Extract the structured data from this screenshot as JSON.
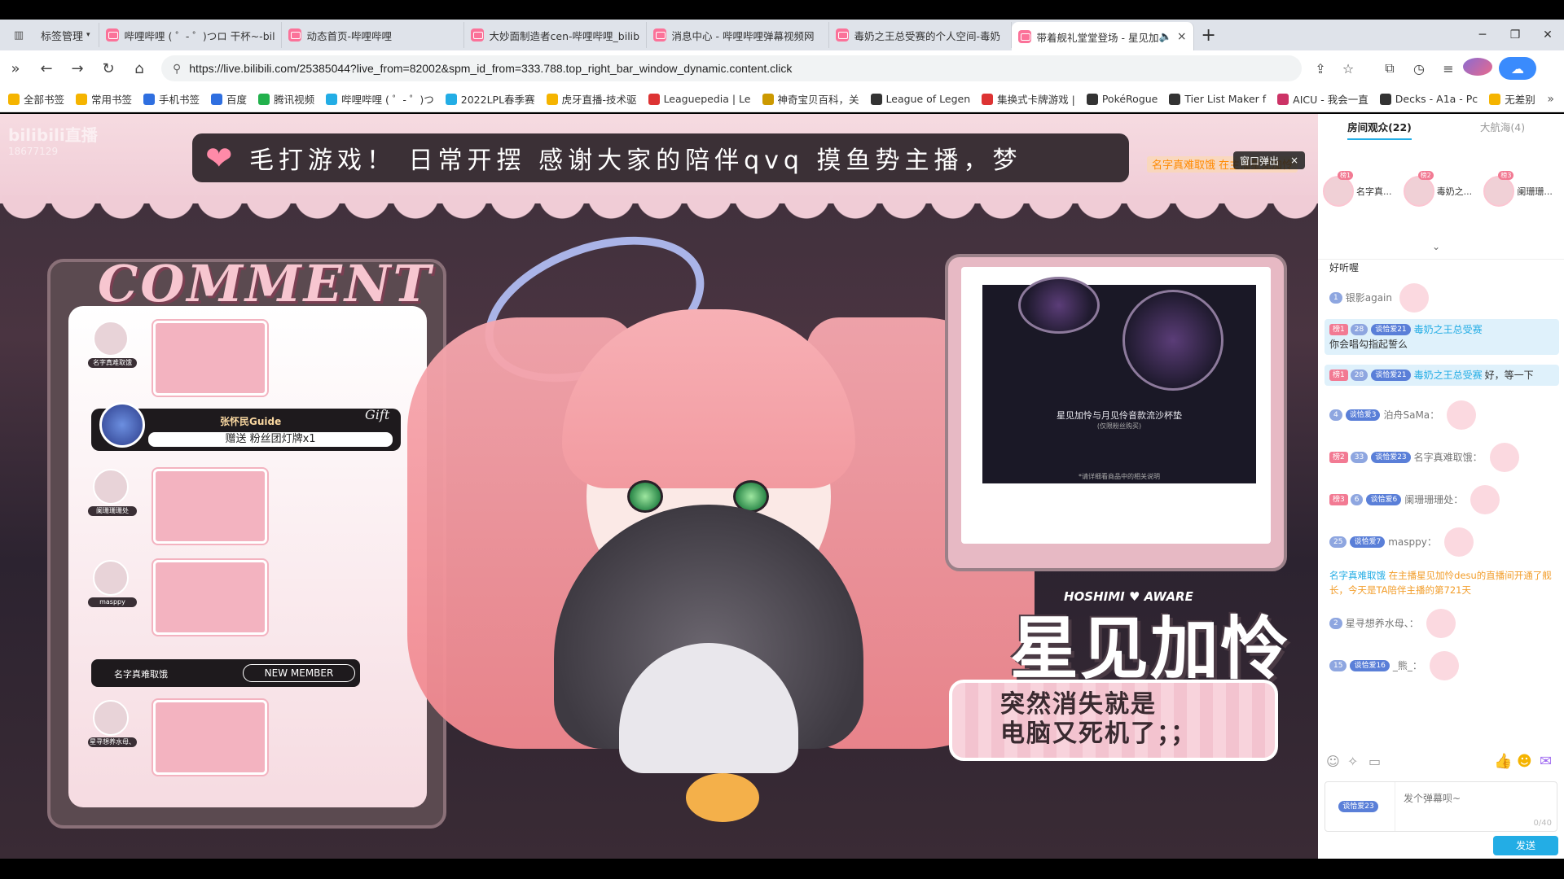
{
  "tabbar": {
    "bookmark_manager": "标签管理",
    "tabs": [
      {
        "title": "哔哩哔哩 ( ゜- ゜)つロ 干杯~-bili"
      },
      {
        "title": "动态首页-哔哩哔哩"
      },
      {
        "title": "大妙面制造者cen-哔哩哔哩_bilib"
      },
      {
        "title": "消息中心 - 哔哩哔哩弹幕视频网"
      },
      {
        "title": "毒奶之王总受赛的个人空间-毒奶"
      },
      {
        "title": "带着舰礼堂堂登场 - 星见加"
      }
    ],
    "new_tab": "+"
  },
  "address": {
    "url": "https://live.bilibili.com/25385044?live_from=82002&spm_id_from=333.788.top_right_bar_window_dynamic.content.click"
  },
  "bookmarks": [
    {
      "label": "全部书签",
      "color": "#f5b400"
    },
    {
      "label": "常用书签",
      "color": "#f5b400"
    },
    {
      "label": "手机书签",
      "color": "#2f6fe0"
    },
    {
      "label": "百度",
      "color": "#2f6fe0"
    },
    {
      "label": "腾讯视频",
      "color": "#22b14c"
    },
    {
      "label": "哔哩哔哩 ( ゜- ゜)つ",
      "color": "#23ade5"
    },
    {
      "label": "2022LPL春季赛",
      "color": "#23ade5"
    },
    {
      "label": "虎牙直播-技术驱",
      "color": "#f5b400"
    },
    {
      "label": "Leaguepedia | Le",
      "color": "#d33"
    },
    {
      "label": "神奇宝贝百科，关",
      "color": "#c90"
    },
    {
      "label": "League of Legen",
      "color": "#333"
    },
    {
      "label": "集换式卡牌游戏 |",
      "color": "#d33"
    },
    {
      "label": "PokéRogue",
      "color": "#333"
    },
    {
      "label": "Tier List Maker f",
      "color": "#333"
    },
    {
      "label": "AICU - 我会一直",
      "color": "#c36"
    },
    {
      "label": "Decks - A1a - Pc",
      "color": "#333"
    },
    {
      "label": "无差别",
      "color": "#f5b400"
    }
  ],
  "stream": {
    "watermark": "bilibili直播",
    "room_number": "18677129",
    "marquee": "毛打游戏！ 日常开摆 感谢大家的陪伴qvq 摸鱼势主播，梦",
    "popout": "窗口弹出",
    "enter_notice": "名字真难取饿 在主播星见加怜",
    "comment_title": "COMMENT",
    "comments": [
      {
        "name": "名字真难取饿"
      },
      {
        "name": "阑珊珊珊处"
      },
      {
        "name": "masppy"
      },
      {
        "name": "星寻想养水母、"
      }
    ],
    "gift": {
      "name": "张怀民Guide",
      "text": "赠送 粉丝团灯牌x1",
      "tag": "Gift"
    },
    "new_member": {
      "name": "名字真难取饿",
      "tag": "NEW MEMBER"
    },
    "media_caption": "星见加怜与月见伶音款流沙杯垫",
    "media_sub": "(仅限粉丝购买)",
    "media_note": "*请详细看商品中的相关说明",
    "logo_tag": "HOSHIMI ♥ AWARE",
    "logo_name": "星见加怜",
    "note_line1": "突然消失就是",
    "note_line2": "电脑又死机了；；"
  },
  "sidebar": {
    "tab_audience": "房间观众(22)",
    "tab_fleet": "大航海(4)",
    "top_viewers": [
      {
        "rank": "榜1",
        "name": "名字真..."
      },
      {
        "rank": "榜2",
        "name": "毒奶之..."
      },
      {
        "rank": "榜3",
        "name": "阑珊珊..."
      }
    ],
    "chat": [
      {
        "text": "好听喔"
      },
      {
        "lvl": "1",
        "name": "银影again",
        "text": ""
      },
      {
        "rank": "榜1",
        "lvl": "28",
        "fan": "谈恰爱21",
        "name": "毒奶之王总受赛",
        "text": "你会唱勾指起誓么"
      },
      {
        "rank": "榜1",
        "lvl": "28",
        "fan": "谈恰爱21",
        "name": "毒奶之王总受赛",
        "text": "好，等一下"
      },
      {
        "lvl": "4",
        "fan": "谈恰爱3",
        "name": "泊舟SaMa：",
        "text": ""
      },
      {
        "rank": "榜2",
        "lvl": "33",
        "fan": "谈恰爱23",
        "name": "名字真难取饿：",
        "text": ""
      },
      {
        "rank": "榜3",
        "lvl": "6",
        "fan": "谈恰爱6",
        "name": "阑珊珊珊处：",
        "text": ""
      },
      {
        "lvl": "25",
        "fan": "谈恰爱7",
        "name": "masppy：",
        "text": ""
      },
      {
        "lvl": "2",
        "name": "星寻想养水母、：",
        "text": ""
      },
      {
        "lvl": "15",
        "fan": "谈恰爱16",
        "name": "_熊_：",
        "text": ""
      }
    ],
    "system_msg": {
      "name": "名字真难取饿",
      "text": "在主播星见加怜desu的直播间开通了舰长，今天是TA陪伴主播的第721天"
    },
    "input_medal": "谈恰爱23",
    "input_placeholder": "发个弹幕呗~",
    "input_count": "0/40",
    "send": "发送"
  }
}
